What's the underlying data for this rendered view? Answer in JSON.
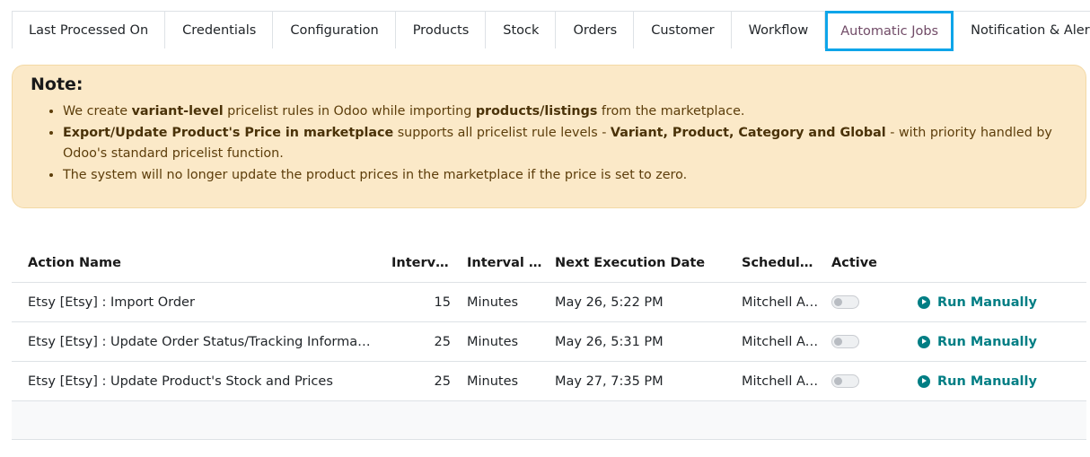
{
  "tabs": [
    {
      "label": "Last Processed On"
    },
    {
      "label": "Credentials"
    },
    {
      "label": "Configuration"
    },
    {
      "label": "Products"
    },
    {
      "label": "Stock"
    },
    {
      "label": "Orders"
    },
    {
      "label": "Customer"
    },
    {
      "label": "Workflow"
    },
    {
      "label": "Automatic Jobs"
    },
    {
      "label": "Notification & Alerts"
    }
  ],
  "note": {
    "title": "Note:",
    "b1": {
      "t1": "We create ",
      "b1": "variant-level",
      "t2": " pricelist rules in Odoo while importing ",
      "b2": "products/listings",
      "t3": " from the marketplace."
    },
    "b2": {
      "b1": "Export/Update Product's Price in marketplace",
      "t1": " supports all pricelist rule levels - ",
      "b2": "Variant, Product, Category and Global",
      "t2": " - with priority handled by Odoo's standard pricelist function."
    },
    "b3": {
      "t1": "The system will no longer update the product prices in the marketplace if the price is set to zero."
    }
  },
  "table": {
    "headers": {
      "name": "Action Name",
      "interval": "Interval Number",
      "unit": "Interval Unit",
      "next": "Next Execution Date",
      "scheduler": "Scheduler User",
      "active": "Active"
    },
    "rows": [
      {
        "name": "Etsy [Etsy] : Import Order",
        "interval": "15",
        "unit": "Minutes",
        "next": "May 26, 5:22 PM",
        "scheduler": "Mitchell Admin",
        "run": "Run Manually"
      },
      {
        "name": "Etsy [Etsy] : Update Order Status/Tracking Information",
        "interval": "25",
        "unit": "Minutes",
        "next": "May 26, 5:31 PM",
        "scheduler": "Mitchell Admin",
        "run": "Run Manually"
      },
      {
        "name": "Etsy [Etsy] : Update Product's Stock and Prices",
        "interval": "25",
        "unit": "Minutes",
        "next": "May 27, 7:35 PM",
        "scheduler": "Mitchell Admin",
        "run": "Run Manually"
      }
    ]
  },
  "colors": {
    "active_tab_border": "#0ea5e9",
    "accent": "#017e84",
    "note_bg": "#fbe9c8"
  }
}
